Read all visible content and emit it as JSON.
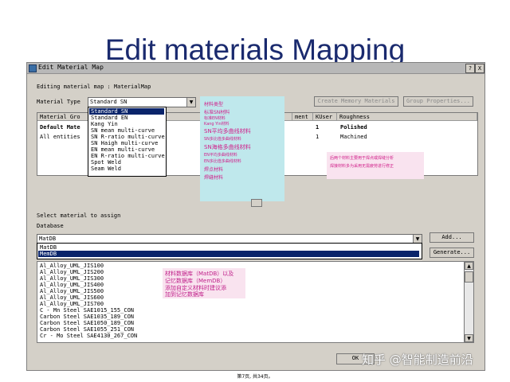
{
  "slide": {
    "title": "Edit materials Mapping",
    "footer": "第7页, 共34页。"
  },
  "window": {
    "title": "Edit Material Map",
    "help_btn": "?",
    "close_btn": "X"
  },
  "form": {
    "editing_label": "Editing material map :  MaterialMap",
    "material_type_label": "Material Type",
    "material_type_value": "Standard SN",
    "create_memory_btn": "Create Memory Materials",
    "group_properties_btn": "Group Properties..."
  },
  "dropdown": {
    "options": [
      "Standard SN",
      "Standard EN",
      "Kang Yin",
      "SN mean multi-curve",
      "SN R-ratio multi-curve",
      "SN Haigh multi-curve",
      "EN mean multi-curve",
      "EN R-ratio multi-curve",
      "Spot Weld",
      "Seam Weld"
    ],
    "selected_index": 0
  },
  "table": {
    "headers": [
      "Material Gro",
      "ment",
      "KUser",
      "Roughness"
    ],
    "rows": [
      {
        "group": "Default Mate",
        "kuser": "1",
        "roughness": "Polished"
      },
      {
        "group": "All entities",
        "kuser": "1",
        "roughness": "Machined"
      }
    ]
  },
  "annotations": {
    "cyan": [
      "材料类型",
      "标准SN材料",
      "标准EN材料",
      "Kang Yin材料",
      "SN平均多曲线材料",
      "SN多比值多曲线材料",
      "SN海格多曲线材料",
      "EN平均多曲线材料",
      "EN多比值多曲线材料",
      "焊点材料",
      "焊缝材料"
    ],
    "pink_right": [
      "后两个材料主要用于焊点或焊缝分析",
      "焊接材料多为采用无需疲劳进行修正"
    ],
    "pink_db": [
      "材料数据库（MatDB）以及",
      "记忆数据库（MemDB）",
      "添加自定义材料时建议添",
      "加到记忆数据库"
    ]
  },
  "select_section": {
    "label": "Select material to assign",
    "database_label": "Database",
    "database_value": "MatDB",
    "db_options": [
      "MatDB",
      "MemDB"
    ],
    "add_btn": "Add...",
    "generate_btn": "Generate..."
  },
  "materials": [
    "Al_Alloy_UML_JIS100",
    "Al_Alloy_UML_JIS200",
    "Al_Alloy_UML_JIS300",
    "Al_Alloy_UML_JIS400",
    "Al_Alloy_UML_JIS500",
    "Al_Alloy_UML_JIS600",
    "Al_Alloy_UML_JIS700",
    "C - Mn Steel SAE1015_155_CON",
    "Carbon Steel SAE1035_189_CON",
    "Carbon Steel SAE1050_189_CON",
    "Carbon Steel SAE1055_251_CON",
    "Cr - Mo Steel SAE4130_267_CON"
  ],
  "ok_btn": "OK",
  "watermark": "知乎 @智能制造前沿"
}
